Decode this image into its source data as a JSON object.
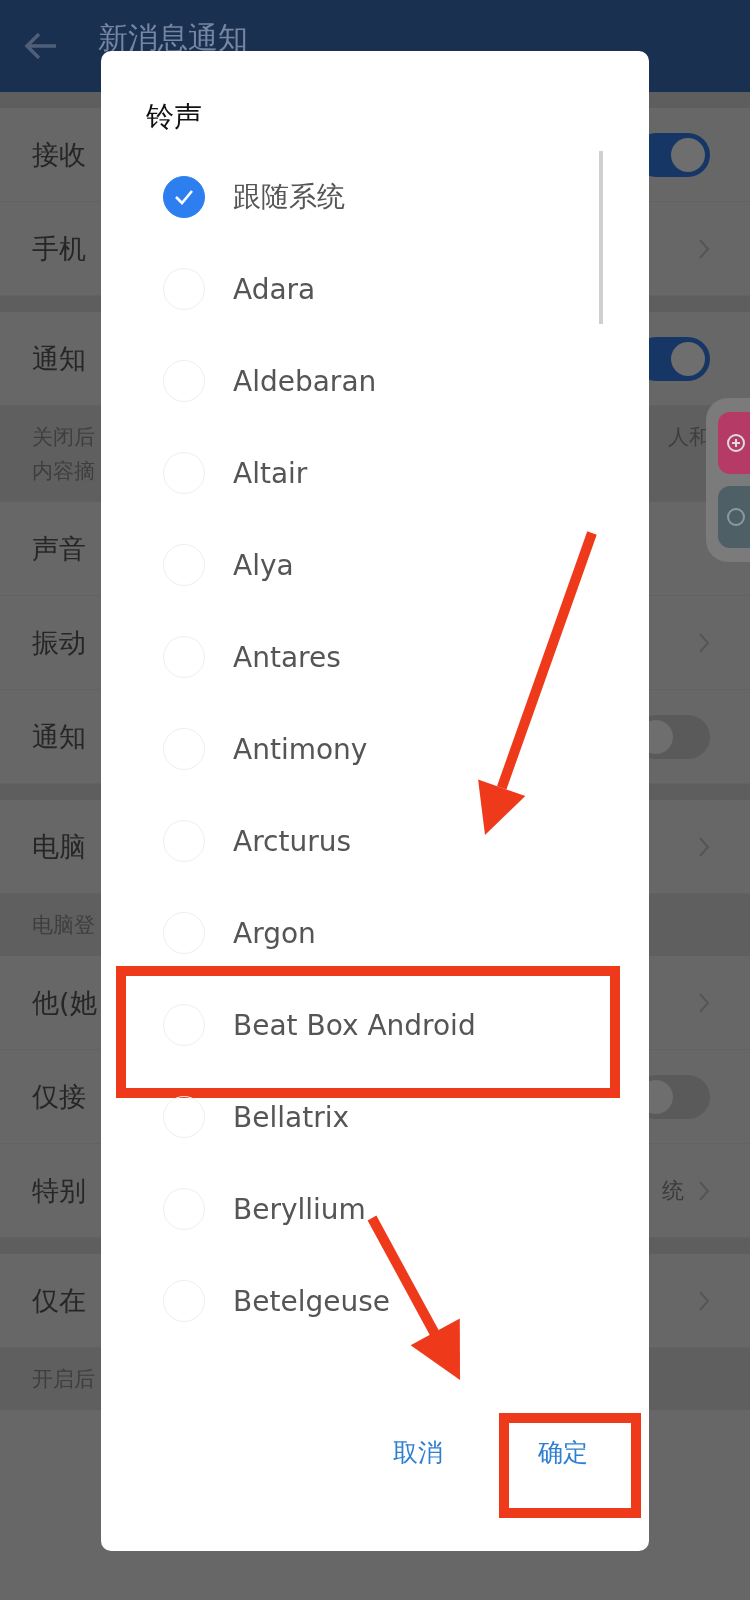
{
  "header": {
    "title": "新消息通知"
  },
  "settings": [
    {
      "kind": "gap"
    },
    {
      "kind": "toggle",
      "label": "接收",
      "on": true
    },
    {
      "kind": "chevron",
      "label": "手机"
    },
    {
      "kind": "gap"
    },
    {
      "kind": "toggle",
      "label": "通知",
      "on": true
    },
    {
      "kind": "note",
      "lines": [
        "关闭后",
        "内容摘"
      ],
      "tail": "人和"
    },
    {
      "kind": "plain",
      "label": "声音"
    },
    {
      "kind": "chevron",
      "label": "振动"
    },
    {
      "kind": "toggle",
      "label": "通知",
      "on": false
    },
    {
      "kind": "gap"
    },
    {
      "kind": "chevron",
      "label": "电脑"
    },
    {
      "kind": "note",
      "lines": [
        "电脑登"
      ]
    },
    {
      "kind": "chevron",
      "label": "他(她"
    },
    {
      "kind": "toggle",
      "label": "仅接",
      "on": false
    },
    {
      "kind": "chevron",
      "label": "特别",
      "value": "统"
    },
    {
      "kind": "gap"
    },
    {
      "kind": "chevron",
      "label": "仅在"
    },
    {
      "kind": "note",
      "lines": [
        "开启后"
      ]
    }
  ],
  "dialog": {
    "title": "铃声",
    "options": [
      {
        "label": "跟随系统",
        "selected": true,
        "highlighted": false
      },
      {
        "label": "Adara",
        "selected": false,
        "highlighted": false
      },
      {
        "label": "Aldebaran",
        "selected": false,
        "highlighted": false
      },
      {
        "label": "Altair",
        "selected": false,
        "highlighted": false
      },
      {
        "label": "Alya",
        "selected": false,
        "highlighted": false
      },
      {
        "label": "Antares",
        "selected": false,
        "highlighted": false
      },
      {
        "label": "Antimony",
        "selected": false,
        "highlighted": false
      },
      {
        "label": "Arcturus",
        "selected": false,
        "highlighted": false
      },
      {
        "label": "Argon",
        "selected": false,
        "highlighted": false
      },
      {
        "label": "Beat Box Android",
        "selected": false,
        "highlighted": true
      },
      {
        "label": "Bellatrix",
        "selected": false,
        "highlighted": false
      },
      {
        "label": "Beryllium",
        "selected": false,
        "highlighted": false
      },
      {
        "label": "Betelgeuse",
        "selected": false,
        "highlighted": false
      }
    ],
    "buttons": [
      {
        "label": "取消",
        "highlighted": false
      },
      {
        "label": "确定",
        "highlighted": true
      }
    ]
  }
}
